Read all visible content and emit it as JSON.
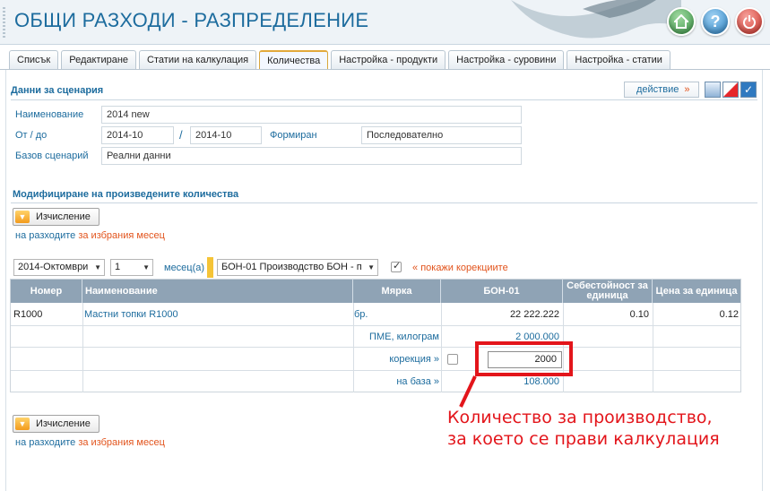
{
  "header": {
    "title": "ОБЩИ РАЗХОДИ - РАЗПРЕДЕЛЕНИЕ",
    "home_icon": "home-icon",
    "help_icon": "help-icon",
    "help_glyph": "?",
    "power_icon": "power-icon",
    "colors": {
      "title": "#1d6c9e",
      "home": "#3c9a49",
      "help": "#2c86c9",
      "power": "#d1332a"
    }
  },
  "tabs": [
    {
      "label": "Списък",
      "active": false
    },
    {
      "label": "Редактиране",
      "active": false
    },
    {
      "label": "Статии на калкулация",
      "active": false
    },
    {
      "label": "Количества",
      "active": true
    },
    {
      "label": "Настройка - продукти",
      "active": false
    },
    {
      "label": "Настройка - суровини",
      "active": false
    },
    {
      "label": "Настройка - статии",
      "active": false
    }
  ],
  "scenario": {
    "section_title": "Данни за сценария",
    "action_label": "действие",
    "action_arrow": "»",
    "name_label": "Наименование",
    "name_value": "2014 new",
    "period_label": "От / до",
    "from_value": "2014-10",
    "slash": "/",
    "to_value": "2014-10",
    "formed_label": "Формиран",
    "formed_value": "Последователно",
    "base_label": "Базов сценарий",
    "base_value": "Реални данни"
  },
  "quantities": {
    "section_title": "Модифициране на произведените количества",
    "calc_button": "Изчисление",
    "expenses_prefix": "на разходите",
    "expenses_suffix": "за избрания месец",
    "month_value": "2014-Октомври",
    "count_value": "1",
    "month_unit": "месец(а)",
    "product_value": "БОН-01 Производство БОН - п",
    "show_corrections_arrow": "«",
    "show_corrections": "покажи корекциите",
    "show_corrections_checked": true
  },
  "table": {
    "headers": [
      "Номер",
      "Наименование",
      "Мярка",
      "БОН-01",
      "Себестойност за единица",
      "Цена за единица"
    ],
    "row": {
      "number": "R1000",
      "name": "Мастни топки R1000",
      "unit": "бр.",
      "bon": "22 222.222",
      "cost": "0.10",
      "price": "0.12"
    },
    "pme_label": "ПМЕ, килограм",
    "pme_value": "2 000.000",
    "correction_label": "корекция »",
    "correction_value": "2000",
    "base_label": "на база »",
    "base_value": "108.000"
  },
  "bottom": {
    "calc_button": "Изчисление",
    "expenses_prefix": "на разходите",
    "expenses_suffix": "за избрания месец"
  },
  "annotation": {
    "line1": "Количество за производство,",
    "line2": "за което се прави калкулация",
    "color": "#e3151b"
  }
}
